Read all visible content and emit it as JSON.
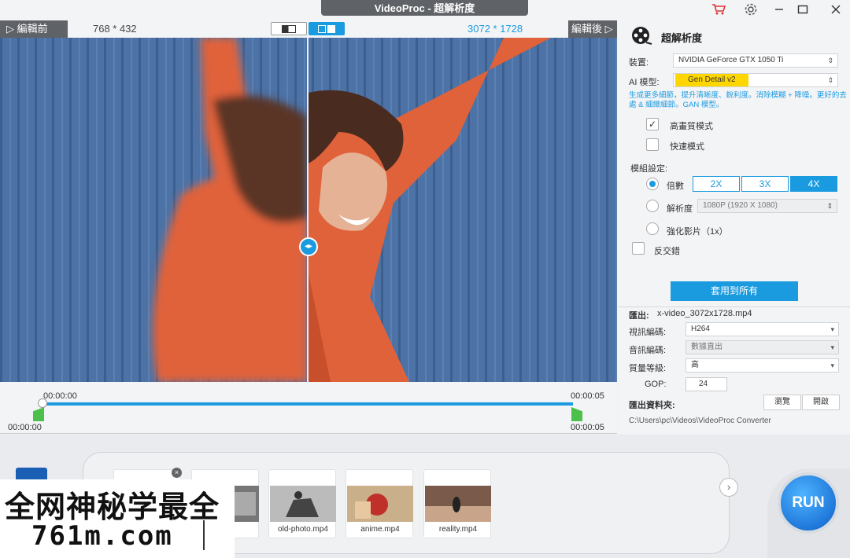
{
  "app": {
    "title": "VideoProc - 超解析度"
  },
  "preview": {
    "before_label": "▷ 編輯前",
    "after_label": "編輯後 ▷",
    "before_resolution": "768 * 432",
    "after_resolution": "3072 * 1728"
  },
  "timeline": {
    "start_top": "00:00:00",
    "end_top": "00:00:05",
    "start_bottom": "00:00:00",
    "end_bottom": "00:00:05"
  },
  "panel": {
    "title": "超解析度",
    "device_label": "裝置:",
    "device_value": "NVIDIA GeForce GTX 1050 Ti",
    "model_label": "AI 模型:",
    "model_value": "Gen Detail v2",
    "description": "生成更多細節，提升清晰度、銳利度。消除模糊 + 降噪。更好的去處 & 細緻細節。GAN 模型。",
    "hq_mode": "高畫質模式",
    "fast_mode": "快速模式",
    "group_label": "模組設定:",
    "scale_label": "倍數",
    "scale_options": [
      "2X",
      "3X",
      "4X"
    ],
    "resolution_label": "解析度",
    "resolution_value": "1080P (1920 X 1080)",
    "enhance_label": "強化影片（1x）",
    "deinterlace_label": "反交錯",
    "apply_all": "套用到所有"
  },
  "output": {
    "label": "匯出:",
    "filename": "x-video_3072x1728.mp4",
    "video_codec_label": "視訊編碼:",
    "video_codec": "H264",
    "audio_codec_label": "音訊編碼:",
    "audio_codec": "數據直出",
    "quality_label": "質量等級:",
    "quality": "高",
    "gop_label": "GOP:",
    "gop": "24",
    "folder_label": "匯出資料夾:",
    "browse": "瀏覽",
    "open": "開啟",
    "path": "C:\\Users\\pc\\Videos\\VideoProc Converter"
  },
  "files": [
    {
      "name": "mp4"
    },
    {
      "name": "old-photo.mp4"
    },
    {
      "name": "anime.mp4"
    },
    {
      "name": "reality.mp4"
    }
  ],
  "run_label": "RUN",
  "watermark": {
    "line1": "全网神秘学最全",
    "line2": "761m.com"
  },
  "colors": {
    "accent": "#1a9be0",
    "model_highlight": "#ffd600",
    "cart": "#d33333",
    "run": "#0c5fc9"
  }
}
